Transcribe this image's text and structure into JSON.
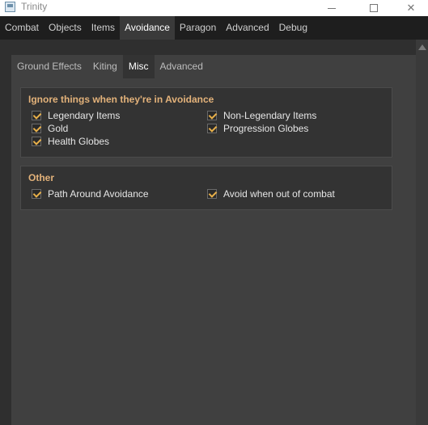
{
  "window": {
    "title": "Trinity"
  },
  "top_tabs": [
    "Combat",
    "Objects",
    "Items",
    "Avoidance",
    "Paragon",
    "Advanced",
    "Debug"
  ],
  "top_tab_active": "Avoidance",
  "sub_tabs": [
    "Ground Effects",
    "Kiting",
    "Misc",
    "Advanced"
  ],
  "sub_tab_active": "Misc",
  "groups": {
    "ignore": {
      "title": "Ignore things when they're in Avoidance",
      "items": [
        {
          "label": "Legendary Items",
          "checked": true
        },
        {
          "label": "Non-Legendary Items",
          "checked": true
        },
        {
          "label": "Gold",
          "checked": true
        },
        {
          "label": "Progression Globes",
          "checked": true
        },
        {
          "label": "Health Globes",
          "checked": true
        }
      ]
    },
    "other": {
      "title": "Other",
      "items": [
        {
          "label": "Path Around Avoidance",
          "checked": true
        },
        {
          "label": "Avoid when out of combat",
          "checked": true
        }
      ]
    }
  },
  "colors": {
    "accent": "#e3b27a",
    "check": "#e8b04a",
    "nav_bg": "#1e1e1e",
    "panel_bg": "#404040"
  }
}
